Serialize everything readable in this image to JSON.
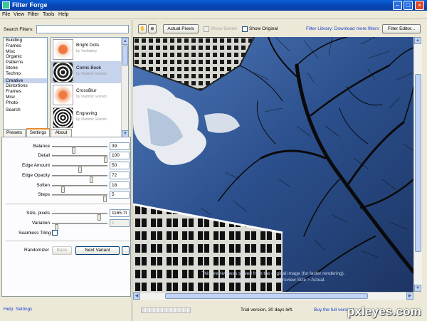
{
  "window": {
    "title": "Filter Forge"
  },
  "menu": [
    "File",
    "View",
    "Filter",
    "Tools",
    "Help"
  ],
  "search": {
    "label": "Search Filters:",
    "value": ""
  },
  "categories": [
    "Building",
    "Frames",
    "Misc",
    "Organic",
    "Patterns",
    "Stone",
    "Techno",
    "Creative",
    "Distortions",
    "Frames",
    "Misc",
    "Photo",
    "Search"
  ],
  "selected_category": "Creative",
  "filters": [
    {
      "name": "Bright Dots",
      "author": "by Yoshiakey"
    },
    {
      "name": "Comic Book",
      "author": "by Vladimir Golovin"
    },
    {
      "name": "CrossBlur",
      "author": "by Vladimir Golovin"
    },
    {
      "name": "Engraving",
      "author": "by Vladimir Golovin"
    }
  ],
  "tabs": [
    "Presets",
    "Settings",
    "About"
  ],
  "active_tab": "Settings",
  "params": [
    {
      "label": "Balance",
      "value": "39",
      "level": 0.39
    },
    {
      "label": "Detail",
      "value": "100",
      "level": 1.0
    },
    {
      "label": "Edge Amount",
      "value": "50",
      "level": 0.5
    },
    {
      "label": "Edge Opacity",
      "value": "72",
      "level": 0.72
    },
    {
      "label": "Soften",
      "value": "18",
      "level": 0.18
    },
    {
      "label": "Steps",
      "value": "5",
      "level": 0.98
    }
  ],
  "size": {
    "label": "Size, pixels",
    "value": "1165.7t",
    "level": 0.88
  },
  "variation": {
    "label": "Variation",
    "value": "1",
    "level": 0.05
  },
  "seamless": {
    "label": "Seamless Tiling",
    "checked": false
  },
  "randomizer": {
    "label": "Randomizer",
    "back": "Back",
    "next": "Next Variant",
    "more": ""
  },
  "help": "Help: Settings",
  "toolbar": {
    "actual_pixels": "Actual Pixels",
    "show_border": "Show Border",
    "show_original": "Show Original",
    "library_link": "Filter Library: Download more filters",
    "editor": "Filter Editor..."
  },
  "preview_note": {
    "line1": "This preview was scaled from the original image (for faster rendering).",
    "line2": "For actual size, click View > Preview Size > Actual."
  },
  "status": {
    "trial": "Trial version, 30 days left.",
    "buy": "Buy the full version!"
  },
  "watermark": "pxleyes.com",
  "colors": {
    "accent": "#e68b2c",
    "link": "#1c3fcf",
    "selection": "#c5d3ec",
    "sky": "#2e4f86"
  }
}
